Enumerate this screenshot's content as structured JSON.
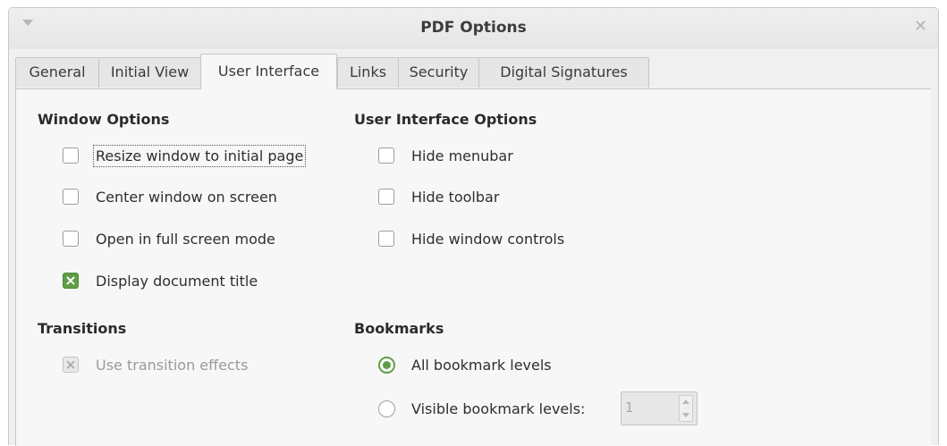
{
  "window": {
    "title": "PDF Options",
    "menu_icon": "dropdown-arrow-icon",
    "close_icon": "close-icon"
  },
  "tabs": [
    {
      "label": "General"
    },
    {
      "label": "Initial View"
    },
    {
      "label": "User Interface",
      "active": true
    },
    {
      "label": "Links"
    },
    {
      "label": "Security"
    },
    {
      "label": "Digital Signatures"
    }
  ],
  "window_options": {
    "heading": "Window Options",
    "items": [
      {
        "label": "Resize window to initial page",
        "checked": false
      },
      {
        "label": "Center window on screen",
        "checked": false
      },
      {
        "label": "Open in full screen mode",
        "checked": false
      },
      {
        "label": "Display document title",
        "checked": true
      }
    ]
  },
  "ui_options": {
    "heading": "User Interface Options",
    "items": [
      {
        "label": "Hide menubar",
        "checked": false
      },
      {
        "label": "Hide toolbar",
        "checked": false
      },
      {
        "label": "Hide window controls",
        "checked": false
      }
    ]
  },
  "transitions": {
    "heading": "Transitions",
    "use_effects": {
      "label": "Use transition effects",
      "checked": true,
      "disabled": true
    }
  },
  "bookmarks": {
    "heading": "Bookmarks",
    "all_levels": {
      "label": "All bookmark levels",
      "selected": true
    },
    "visible_levels": {
      "label": "Visible bookmark levels:",
      "selected": false,
      "value": "1"
    }
  },
  "colors": {
    "accent": "#5f9e47",
    "panel_bg": "#f7f7f7",
    "window_bg": "#f0f0f0"
  }
}
